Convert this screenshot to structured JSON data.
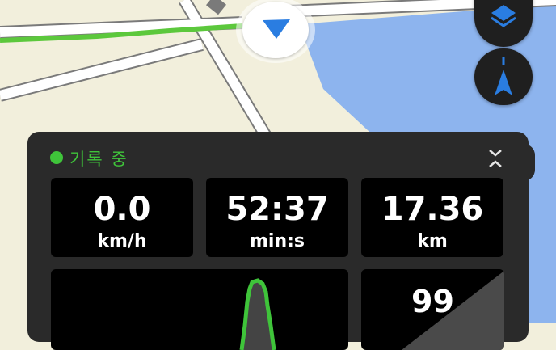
{
  "map": {
    "colors": {
      "land": "#f2efdc",
      "water": "#8db4ee",
      "road": "#ffffff",
      "road_edge": "#7a7a7a",
      "track": "#5cc83c"
    },
    "icons": {
      "layers": "layers-icon",
      "compass": "compass-arrow-icon",
      "location": "location-arrow-icon"
    }
  },
  "panel": {
    "status_label": "기록 중",
    "status_color": "#3fc43a",
    "collapse_icon": "collapse-icon",
    "stats": [
      {
        "value": "0.0",
        "unit": "km/h"
      },
      {
        "value": "52:37",
        "unit": "min:s"
      },
      {
        "value": "17.36",
        "unit": "km"
      }
    ],
    "elevation_value": "99"
  }
}
